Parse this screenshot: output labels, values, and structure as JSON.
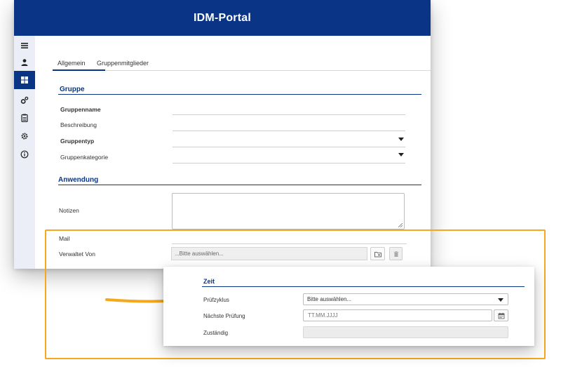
{
  "app": {
    "title": "IDM-Portal"
  },
  "sidebar": {
    "items": [
      {
        "icon": "menu-icon",
        "active": false
      },
      {
        "icon": "user-icon",
        "active": false
      },
      {
        "icon": "grid-icon",
        "active": true
      },
      {
        "icon": "gears-icon",
        "active": false
      },
      {
        "icon": "clipboard-icon",
        "active": false
      },
      {
        "icon": "gear-icon",
        "active": false
      },
      {
        "icon": "info-icon",
        "active": false
      }
    ]
  },
  "tabs": [
    {
      "label": "Allgemein",
      "active": true
    },
    {
      "label": "Gruppenmitglieder",
      "active": false
    }
  ],
  "sections": {
    "gruppe": {
      "title": "Gruppe",
      "fields": {
        "gruppenname": {
          "label": "Gruppenname",
          "value": ""
        },
        "beschreibung": {
          "label": "Beschreibung",
          "value": ""
        },
        "gruppentyp": {
          "label": "Gruppentyp",
          "value": ""
        },
        "gruppenkategorie": {
          "label": "Gruppenkategorie",
          "value": ""
        }
      }
    },
    "anwendung": {
      "title": "Anwendung",
      "fields": {
        "notizen": {
          "label": "Notizen",
          "value": ""
        },
        "mail": {
          "label": "Mail",
          "value": ""
        },
        "verwaltet_von": {
          "label": "Verwaltet Von",
          "placeholder": "...Bitte auswählen..."
        }
      }
    }
  },
  "popup": {
    "title": "Zeit",
    "fields": {
      "pruefzyklus": {
        "label": "Prüfzyklus",
        "value": "Bitte auswählen..."
      },
      "naechste_pruefung": {
        "label": "Nächste Prüfung",
        "placeholder": "TT.MM.JJJJ"
      },
      "zustaendig": {
        "label": "Zuständig",
        "value": ""
      }
    }
  },
  "colors": {
    "brand": "#0a3586",
    "highlight": "#f5a81c"
  }
}
